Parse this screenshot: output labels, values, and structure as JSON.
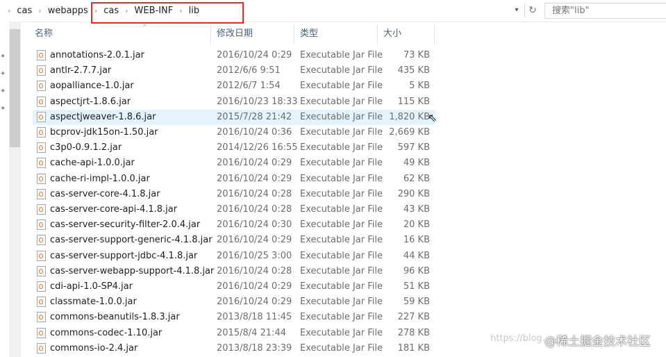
{
  "breadcrumb": [
    "cas",
    "webapps",
    "cas",
    "WEB-INF",
    "lib"
  ],
  "search": {
    "placeholder": "搜索\"lib\""
  },
  "columns": {
    "name": "名称",
    "date": "修改日期",
    "type": "类型",
    "size": "大小"
  },
  "files": [
    {
      "name": "annotations-2.0.1.jar",
      "date": "2016/10/24 0:29",
      "type": "Executable Jar File",
      "size": "73 KB"
    },
    {
      "name": "antlr-2.7.7.jar",
      "date": "2012/6/6 9:51",
      "type": "Executable Jar File",
      "size": "435 KB"
    },
    {
      "name": "aopalliance-1.0.jar",
      "date": "2012/6/7 1:54",
      "type": "Executable Jar File",
      "size": "5 KB"
    },
    {
      "name": "aspectjrt-1.8.6.jar",
      "date": "2016/10/23 18:33",
      "type": "Executable Jar File",
      "size": "115 KB"
    },
    {
      "name": "aspectjweaver-1.8.6.jar",
      "date": "2015/7/28 21:42",
      "type": "Executable Jar File",
      "size": "1,820 KB"
    },
    {
      "name": "bcprov-jdk15on-1.50.jar",
      "date": "2016/10/24 0:36",
      "type": "Executable Jar File",
      "size": "2,669 KB"
    },
    {
      "name": "c3p0-0.9.1.2.jar",
      "date": "2014/12/26 16:55",
      "type": "Executable Jar File",
      "size": "597 KB"
    },
    {
      "name": "cache-api-1.0.0.jar",
      "date": "2016/10/24 0:29",
      "type": "Executable Jar File",
      "size": "49 KB"
    },
    {
      "name": "cache-ri-impl-1.0.0.jar",
      "date": "2016/10/24 0:29",
      "type": "Executable Jar File",
      "size": "62 KB"
    },
    {
      "name": "cas-server-core-4.1.8.jar",
      "date": "2016/10/24 0:28",
      "type": "Executable Jar File",
      "size": "290 KB"
    },
    {
      "name": "cas-server-core-api-4.1.8.jar",
      "date": "2016/10/24 0:28",
      "type": "Executable Jar File",
      "size": "43 KB"
    },
    {
      "name": "cas-server-security-filter-2.0.4.jar",
      "date": "2016/10/24 0:30",
      "type": "Executable Jar File",
      "size": "20 KB"
    },
    {
      "name": "cas-server-support-generic-4.1.8.jar",
      "date": "2016/10/24 0:29",
      "type": "Executable Jar File",
      "size": "16 KB"
    },
    {
      "name": "cas-server-support-jdbc-4.1.8.jar",
      "date": "2016/10/25 3:00",
      "type": "Executable Jar File",
      "size": "44 KB"
    },
    {
      "name": "cas-server-webapp-support-4.1.8.jar",
      "date": "2016/10/24 0:28",
      "type": "Executable Jar File",
      "size": "96 KB"
    },
    {
      "name": "cdi-api-1.0-SP4.jar",
      "date": "2016/10/24 0:29",
      "type": "Executable Jar File",
      "size": "51 KB"
    },
    {
      "name": "classmate-1.0.0.jar",
      "date": "2016/10/24 0:29",
      "type": "Executable Jar File",
      "size": "59 KB"
    },
    {
      "name": "commons-beanutils-1.8.3.jar",
      "date": "2013/8/18 11:45",
      "type": "Executable Jar File",
      "size": "227 KB"
    },
    {
      "name": "commons-codec-1.10.jar",
      "date": "2015/8/4 21:44",
      "type": "Executable Jar File",
      "size": "278 KB"
    },
    {
      "name": "commons-io-2.4.jar",
      "date": "2013/8/18 23:39",
      "type": "Executable Jar File",
      "size": "181 KB"
    }
  ],
  "selected_index": 4,
  "watermark": "https://blog.",
  "brand": "@稀土掘金技术社区",
  "colors": {
    "highlight_box": "#e0312d",
    "selected_row": "#e5f3ff",
    "header_text": "#4c607a"
  },
  "icons": [
    "chevron-right-icon",
    "dropdown-arrow-icon",
    "refresh-icon",
    "pin-icon",
    "jar-file-icon",
    "mouse-cursor-icon"
  ]
}
